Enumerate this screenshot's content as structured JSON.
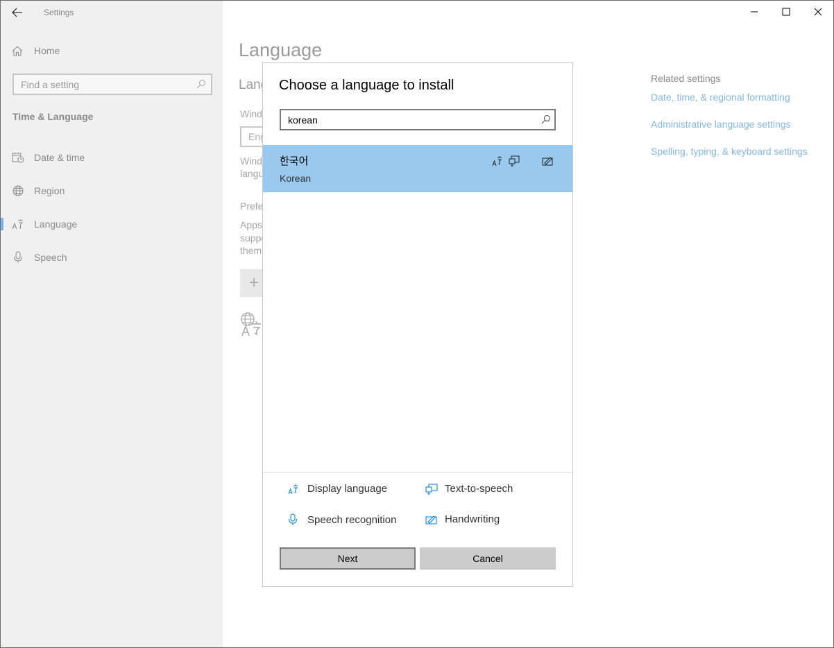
{
  "window": {
    "app_title": "Settings"
  },
  "sidebar": {
    "home_label": "Home",
    "search_placeholder": "Find a setting",
    "section_title": "Time & Language",
    "items": [
      {
        "label": "Date & time",
        "icon": "calendar-clock-icon"
      },
      {
        "label": "Region",
        "icon": "globe-icon"
      },
      {
        "label": "Language",
        "icon": "language-icon",
        "active": true
      },
      {
        "label": "Speech",
        "icon": "microphone-icon"
      }
    ]
  },
  "main": {
    "page_title": "Language",
    "ghost": {
      "subheading": "Lang",
      "windows_display": "Wind",
      "input_value": "Eng",
      "windows_line1": "Wind",
      "windows_line2": "langu",
      "preferred": "Prefe",
      "apps_line1": "Apps",
      "apps_line2": "suppo",
      "apps_line3": "them"
    },
    "related": {
      "title": "Related settings",
      "links": [
        "Date, time, & regional formatting",
        "Administrative language settings",
        "Spelling, typing, & keyboard settings"
      ]
    }
  },
  "dialog": {
    "title": "Choose a language to install",
    "search_value": "korean",
    "results": [
      {
        "native": "한국어",
        "english": "Korean",
        "features": [
          "display-language",
          "text-to-speech",
          "handwriting"
        ]
      }
    ],
    "legend": {
      "display_language": "Display language",
      "text_to_speech": "Text-to-speech",
      "speech_recognition": "Speech recognition",
      "handwriting": "Handwriting"
    },
    "buttons": {
      "next": "Next",
      "cancel": "Cancel"
    }
  },
  "colors": {
    "accent": "#0078d7",
    "selection": "#99c9ef",
    "link": "#86b8e2"
  }
}
